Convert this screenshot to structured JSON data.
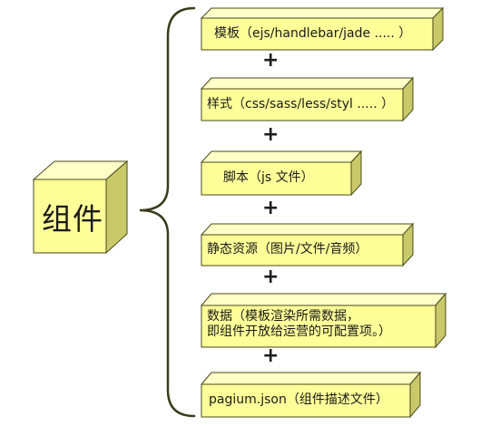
{
  "main": {
    "label": "组件"
  },
  "boxes": [
    {
      "id": "template",
      "lines": [
        "模板（ejs/handlebar/jade ..... ）"
      ]
    },
    {
      "id": "style",
      "lines": [
        "样式（css/sass/less/styl ..... ）"
      ]
    },
    {
      "id": "script",
      "lines": [
        "脚本（js 文件）"
      ]
    },
    {
      "id": "static",
      "lines": [
        "静态资源（图片/文件/音频）"
      ]
    },
    {
      "id": "data",
      "lines": [
        "数据（模板渲染所需数据，",
        "即组件开放给运营的可配置项。）"
      ]
    },
    {
      "id": "pagium",
      "lines": [
        "pagium.json（组件描述文件）"
      ]
    }
  ],
  "connector": {
    "symbol": "+"
  },
  "colors": {
    "box_front": "#ffff99",
    "box_top": "#ffffc8",
    "box_side": "#c9c96a",
    "border": "#4a4a1a",
    "brace": "#3b3b1c"
  }
}
